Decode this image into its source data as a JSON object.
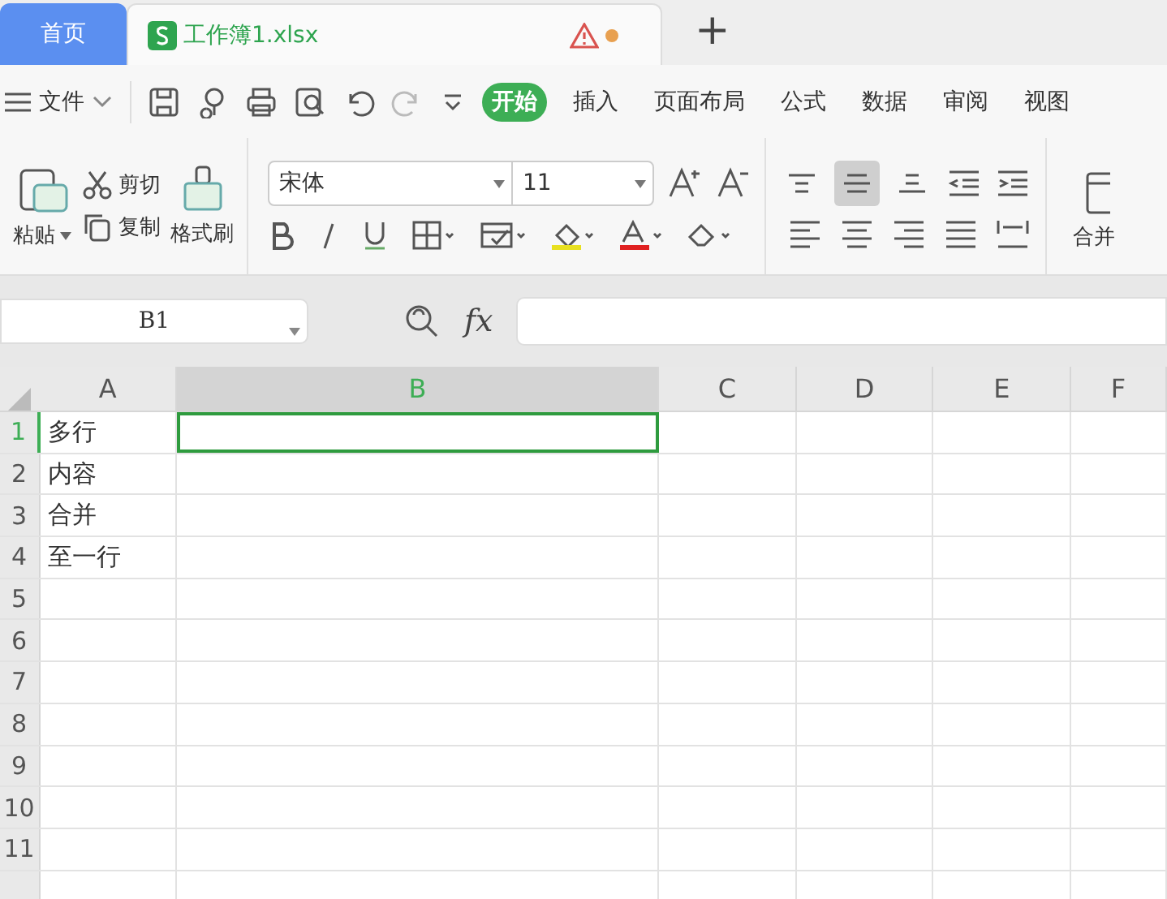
{
  "tabs": [
    {
      "label": "首页",
      "kind": "home",
      "selected": false
    },
    {
      "label": "工作簿1.xlsx",
      "kind": "file",
      "selected": true,
      "unsaved": true
    }
  ],
  "new_tab": "+",
  "file_menu": "文件",
  "ribbon_tabs": [
    {
      "label": "开始",
      "selected": true
    },
    {
      "label": "插入",
      "selected": false
    },
    {
      "label": "页面布局",
      "selected": false
    },
    {
      "label": "公式",
      "selected": false
    },
    {
      "label": "数据",
      "selected": false
    },
    {
      "label": "审阅",
      "selected": false
    },
    {
      "label": "视图",
      "selected": false
    }
  ],
  "clipboard": {
    "paste": "粘贴",
    "cut": "剪切",
    "copy": "复制",
    "format_painter": "格式刷"
  },
  "font": {
    "name": "宋体",
    "size": "11"
  },
  "alignment": [
    {
      "kind": "top",
      "selected": false
    },
    {
      "kind": "middle",
      "selected": true
    },
    {
      "kind": "bottom",
      "selected": false
    }
  ],
  "merge": "合并",
  "name_box": "B1",
  "fx": "fx",
  "columns": [
    {
      "label": "A",
      "selected": false
    },
    {
      "label": "B",
      "selected": true
    },
    {
      "label": "C",
      "selected": false
    },
    {
      "label": "D",
      "selected": false
    },
    {
      "label": "E",
      "selected": false
    },
    {
      "label": "F",
      "selected": false
    }
  ],
  "rows": [
    {
      "label": "1",
      "selected": true,
      "column_a": "多行"
    },
    {
      "label": "2",
      "selected": false,
      "column_a": "内容"
    },
    {
      "label": "3",
      "selected": false,
      "column_a": "合并"
    },
    {
      "label": "4",
      "selected": false,
      "column_a": "至一行"
    },
    {
      "label": "5",
      "selected": false
    },
    {
      "label": "6",
      "selected": false
    },
    {
      "label": "7",
      "selected": false
    },
    {
      "label": "8",
      "selected": false
    },
    {
      "label": "9",
      "selected": false
    },
    {
      "label": "10",
      "selected": false
    },
    {
      "label": "11",
      "selected": false
    }
  ]
}
